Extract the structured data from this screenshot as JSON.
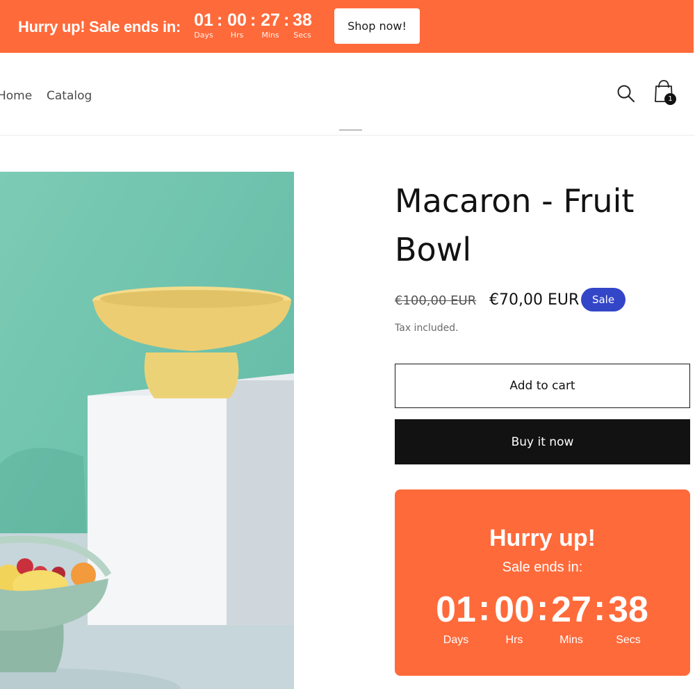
{
  "announcement": {
    "text": "Hurry up! Sale ends in:",
    "timer": {
      "days": "01",
      "hours": "00",
      "mins": "27",
      "secs": "38",
      "days_label": "Days",
      "hours_label": "Hrs",
      "mins_label": "Mins",
      "secs_label": "Secs",
      "separator": ":"
    },
    "cta_label": "Shop now!"
  },
  "nav": {
    "items": [
      {
        "label": "Home"
      },
      {
        "label": "Catalog"
      }
    ],
    "cart_count": "1",
    "icons": [
      "search-icon",
      "shopping-bag-icon"
    ]
  },
  "product": {
    "title": "Macaron - Fruit Bowl",
    "price_original": "€100,00 EUR",
    "price_sale": "€70,00 EUR",
    "badge": "Sale",
    "tax_note": "Tax included.",
    "add_to_cart_label": "Add to cart",
    "buy_now_label": "Buy it now"
  },
  "countdown": {
    "heading": "Hurry up!",
    "subheading": "Sale ends in:",
    "days": "01",
    "hours": "00",
    "mins": "27",
    "secs": "38",
    "days_label": "Days",
    "hours_label": "Hrs",
    "mins_label": "Mins",
    "secs_label": "Secs",
    "separator": ":"
  },
  "colors": {
    "accent": "#ff6a3a",
    "sale_badge": "#3346c8",
    "text": "#121212",
    "button_dark": "#121212",
    "image_background": "#7fc9b3"
  }
}
